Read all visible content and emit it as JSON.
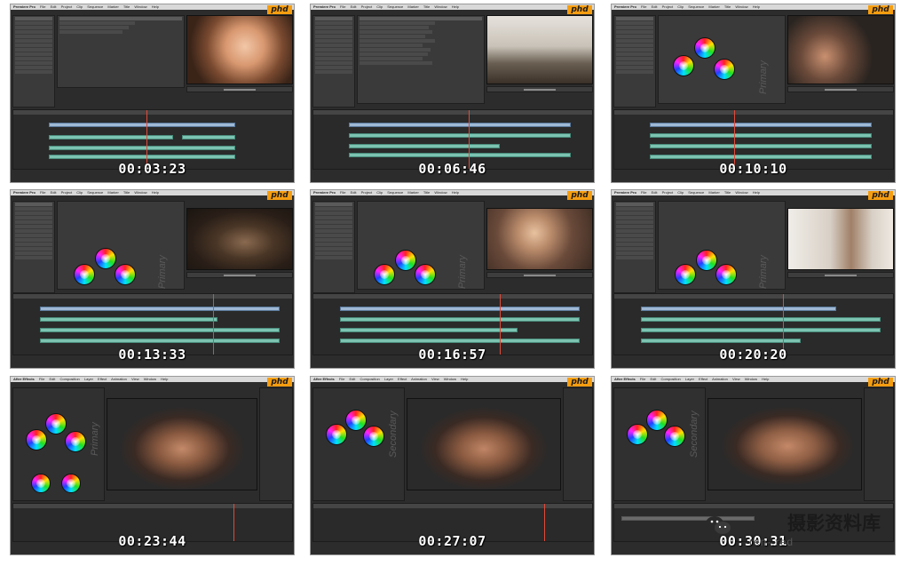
{
  "menu_premiere": {
    "app": "Premiere Pro",
    "items": [
      "File",
      "Edit",
      "Project",
      "Clip",
      "Sequence",
      "Marker",
      "Title",
      "Window",
      "Help"
    ]
  },
  "menu_aftereffects": {
    "app": "After Effects",
    "items": [
      "File",
      "Edit",
      "Composition",
      "Layer",
      "Effect",
      "Animation",
      "View",
      "Window",
      "Help"
    ]
  },
  "logo_text": "phd",
  "frames": [
    {
      "timecode": "00:03:23"
    },
    {
      "timecode": "00:06:46"
    },
    {
      "timecode": "00:10:10",
      "wheel_label": "Primary"
    },
    {
      "timecode": "00:13:33",
      "wheel_label": "Primary"
    },
    {
      "timecode": "00:16:57",
      "wheel_label": "Primary"
    },
    {
      "timecode": "00:20:20",
      "wheel_label": "Primary"
    },
    {
      "timecode": "00:23:44",
      "wheel_label": "Primary"
    },
    {
      "timecode": "00:27:07",
      "wheel_label": "Secondary"
    },
    {
      "timecode": "00:30:31",
      "wheel_label": "Secondary"
    }
  ],
  "watermark": {
    "text": "摄影资料库",
    "sub": "ren·.red"
  }
}
